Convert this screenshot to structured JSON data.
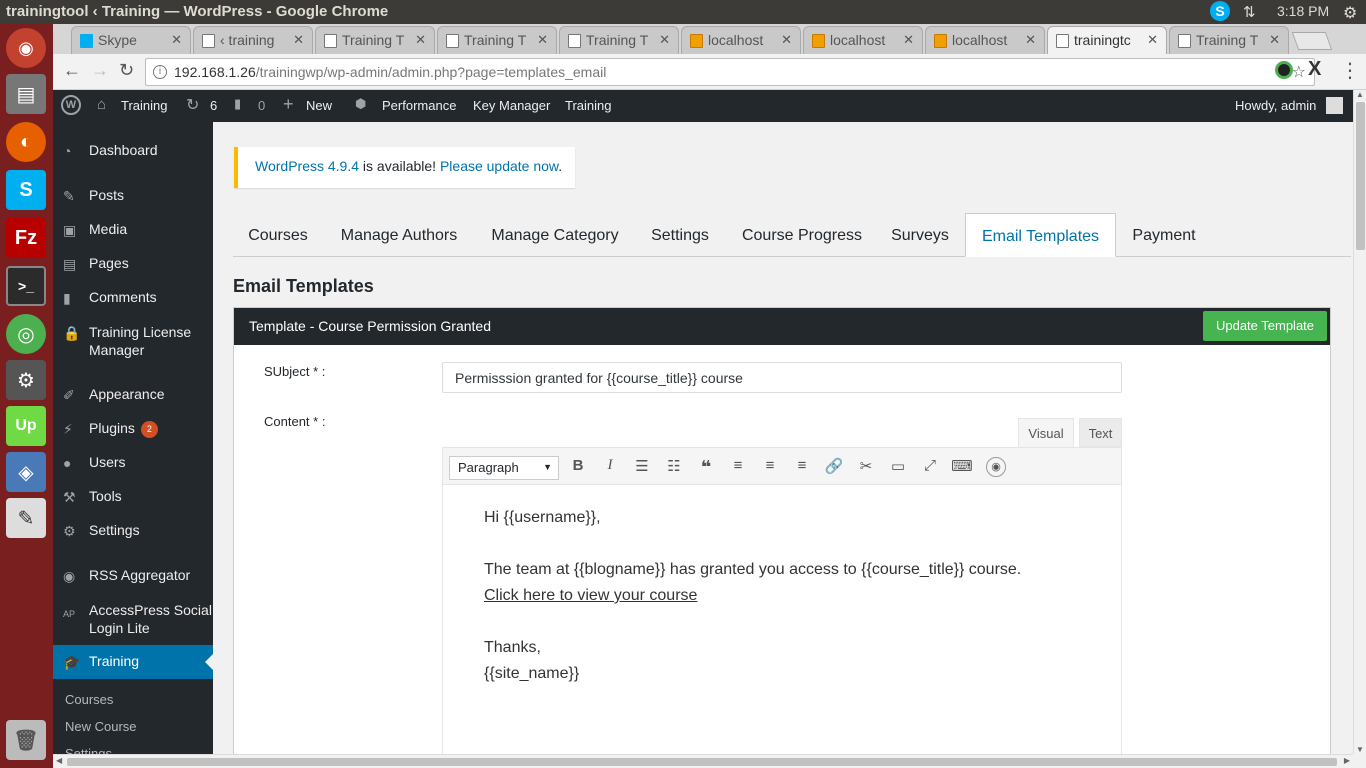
{
  "os": {
    "window_title": "trainingtool ‹ Training — WordPress - Google Chrome",
    "clock": "3:18 PM"
  },
  "browser": {
    "tabs": [
      {
        "label": "Skype"
      },
      {
        "label": "‹ training"
      },
      {
        "label": "Training T"
      },
      {
        "label": "Training T"
      },
      {
        "label": "Training T"
      },
      {
        "label": "localhost"
      },
      {
        "label": "localhost"
      },
      {
        "label": "localhost"
      },
      {
        "label": "trainingtc"
      },
      {
        "label": "Training T"
      }
    ],
    "url_host": "192.168.1.26",
    "url_path": "/trainingwp/wp-admin/admin.php?page=templates_email"
  },
  "adminbar": {
    "site": "Training",
    "updates": "6",
    "comments": "0",
    "new": "New",
    "performance": "Performance",
    "key_manager": "Key Manager",
    "training": "Training",
    "howdy": "Howdy, admin"
  },
  "menu": {
    "dashboard": "Dashboard",
    "posts": "Posts",
    "media": "Media",
    "pages": "Pages",
    "comments": "Comments",
    "license": "Training License Manager",
    "appearance": "Appearance",
    "plugins": "Plugins",
    "plugins_badge": "2",
    "users": "Users",
    "tools": "Tools",
    "settings": "Settings",
    "rss": "RSS Aggregator",
    "ap_icon": "AP",
    "accesspress": "AccessPress Social Login Lite",
    "training": "Training",
    "sub_courses": "Courses",
    "sub_new": "New Course",
    "sub_settings": "Settings"
  },
  "notice": {
    "version_link": "WordPress 4.9.4",
    "mid": " is available! ",
    "update_link": "Please update now",
    "end": "."
  },
  "navtabs": {
    "courses": "Courses",
    "authors": "Manage Authors",
    "category": "Manage Category",
    "settings": "Settings",
    "progress": "Course Progress",
    "surveys": "Surveys",
    "email": "Email Templates",
    "payment": "Payment"
  },
  "page": {
    "heading": "Email Templates",
    "panel_title": "Template - Course Permission Granted",
    "update_button": "Update Template",
    "subject_label": "SUbject * :",
    "subject_value": "Permisssion granted for {{course_title}} course",
    "content_label": "Content * :",
    "visual_tab": "Visual",
    "text_tab": "Text",
    "format_select": "Paragraph"
  },
  "editor": {
    "line1": "Hi {{username}},",
    "line2": "The team at {{blogname}} has granted you access to {{course_title}} course.",
    "link": "Click here to view your course",
    "line3": "Thanks,",
    "line4": "{{site_name}}"
  }
}
